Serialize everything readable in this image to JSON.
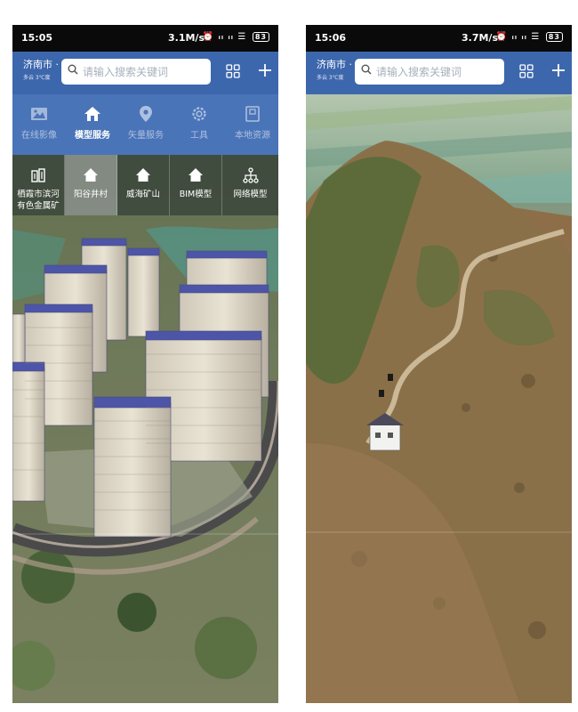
{
  "left_phone": {
    "status": {
      "time": "15:05",
      "rate": "3.1M/s",
      "battery": "83"
    },
    "city": {
      "name": "济南市 ·",
      "sub": "多云 3℃度"
    },
    "search": {
      "placeholder": "请输入搜索关键词"
    },
    "toolbar": [
      {
        "label": "在线影像",
        "icon": "image-icon"
      },
      {
        "label": "模型服务",
        "icon": "home-icon",
        "active": true
      },
      {
        "label": "矢量服务",
        "icon": "location-pin-icon"
      },
      {
        "label": "工具",
        "icon": "gear-icon"
      },
      {
        "label": "本地资源",
        "icon": "document-icon"
      }
    ],
    "subbar": [
      {
        "label_line1": "栖霞市滨河",
        "label_line2": "有色金属矿",
        "icon": "mine-icon"
      },
      {
        "label_line1": "阳谷井村",
        "icon": "home-icon",
        "active": true
      },
      {
        "label_line1": "威海矿山",
        "icon": "home-icon"
      },
      {
        "label_line1": "BIM模型",
        "icon": "home-icon"
      },
      {
        "label_line1": "网络模型",
        "icon": "network-icon"
      }
    ]
  },
  "right_phone": {
    "status": {
      "time": "15:06",
      "rate": "3.7M/s",
      "battery": "83"
    },
    "city": {
      "name": "济南市 ·",
      "sub": "多云 3℃度"
    },
    "search": {
      "placeholder": "请输入搜索关键词"
    }
  },
  "signal_icons": "⏰ ᵢₗ ᵢₗ ☰",
  "colors": {
    "topbar": "#3d67ad",
    "toolbar": "#4a74b8",
    "status_bar": "#0a0a0a"
  }
}
